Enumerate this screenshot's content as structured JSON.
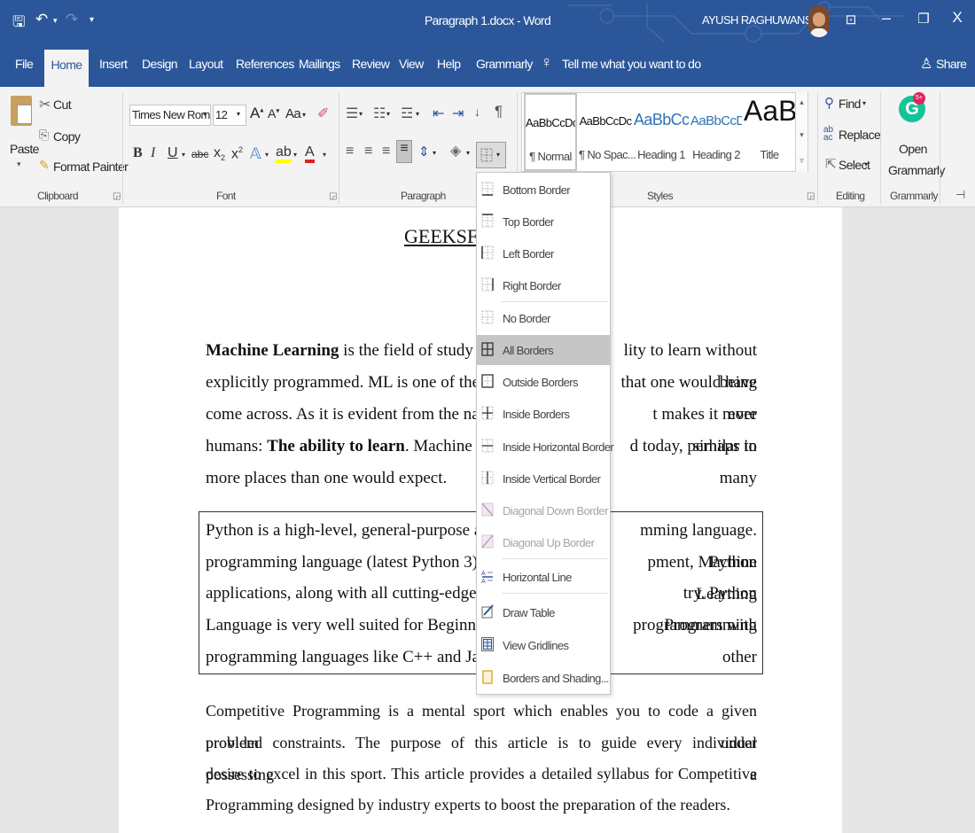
{
  "window": {
    "document_title": "Paragraph 1.docx - Word",
    "user_name": "AYUSH RAGHUWANSHI",
    "minimize": "–",
    "maximize": "❐",
    "close": "X"
  },
  "menu": {
    "tabs": [
      "File",
      "Home",
      "Insert",
      "Design",
      "Layout",
      "References",
      "Mailings",
      "Review",
      "View",
      "Help",
      "Grammarly"
    ],
    "tell_me": "Tell me what you want to do",
    "share": "Share"
  },
  "clipboard": {
    "paste": "Paste",
    "cut": "Cut",
    "copy": "Copy",
    "format_painter": "Format Painter",
    "label": "Clipboard"
  },
  "font": {
    "name": "Times New Roma",
    "size": "12",
    "label": "Font",
    "case": "Aa",
    "bold": "B",
    "italic": "I",
    "underline": "U",
    "strike": "abc",
    "subscript": "x",
    "superscript": "x"
  },
  "paragraph": {
    "label": "Paragraph"
  },
  "styles": {
    "label": "Styles",
    "items": [
      {
        "preview": "AaBbCcDc",
        "name": "¶ Normal"
      },
      {
        "preview": "AaBbCcDc",
        "name": "¶ No Spac..."
      },
      {
        "preview": "AaBbCc",
        "name": "Heading 1"
      },
      {
        "preview": "AaBbCcD",
        "name": "Heading 2"
      },
      {
        "preview": "AaB",
        "name": "Title"
      }
    ]
  },
  "editing": {
    "find": "Find",
    "replace": "Replace",
    "select": "Select",
    "label": "Editing"
  },
  "grammarly": {
    "open_1": "Open",
    "open_2": "Grammarly",
    "label": "Grammarly",
    "badge": "5+"
  },
  "border_menu": [
    {
      "label": "Bottom Border",
      "disabled": false
    },
    {
      "label": "Top Border",
      "disabled": false
    },
    {
      "label": "Left Border",
      "disabled": false
    },
    {
      "label": "Right Border",
      "disabled": false
    },
    {
      "label": "No Border",
      "disabled": false
    },
    {
      "label": "All Borders",
      "disabled": false,
      "selected": true
    },
    {
      "label": "Outside Borders",
      "disabled": false
    },
    {
      "label": "Inside Borders",
      "disabled": false
    },
    {
      "label": "Inside Horizontal Border",
      "disabled": false
    },
    {
      "label": "Inside Vertical Border",
      "disabled": false
    },
    {
      "label": "Diagonal Down Border",
      "disabled": true
    },
    {
      "label": "Diagonal Up Border",
      "disabled": true
    },
    {
      "label": "Horizontal Line",
      "disabled": false
    },
    {
      "label": "Draw Table",
      "disabled": false
    },
    {
      "label": "View Gridlines",
      "disabled": false
    },
    {
      "label": "Borders and Shading...",
      "disabled": false
    }
  ],
  "document": {
    "heading_visible": "GEEKSFO",
    "para1": {
      "bold1": "Machine Learning",
      "text1": " is the field of study that giv",
      "text1b": "lity to learn without being",
      "line2a": "explicitly programmed. ML is one of the most",
      "line2b": "that one would have ever",
      "line3a": "come across. As it is evident from the name, it",
      "line3b": "t makes it more similar to",
      "line4a": "humans: ",
      "bold2": "The ability to learn",
      "line4a2": ". Machine learnir",
      "line4b": "d today, perhaps in many",
      "line5": "more places than one would expect."
    },
    "para2": {
      "l1a": "Python is a high-level, general-purpose and a",
      "l1b": "mming language. Python",
      "l2a": "programming language (latest Python 3) is bei",
      "l2b": "pment, Machine Learning",
      "l3a": "applications, along with all cutting-edge techno",
      "l3b": "try. Python Programming",
      "l4a": "Language is very well suited for Beginners,",
      "l4b": "programmers with other",
      "l5": "programming languages like C++ and Java."
    },
    "para3": [
      "Competitive Programming is a mental sport which enables you to code a given problem under",
      "provided constraints. The purpose of this article is to guide every individual possessing a",
      "desire to excel in this sport. This article provides a detailed syllabus for Competitive",
      "Programming designed by industry experts to boost the preparation of the readers."
    ]
  },
  "colors": {
    "word_blue": "#2b579a",
    "ribbon_bg": "#f3f3f3",
    "grammarly_green": "#15c39a"
  }
}
